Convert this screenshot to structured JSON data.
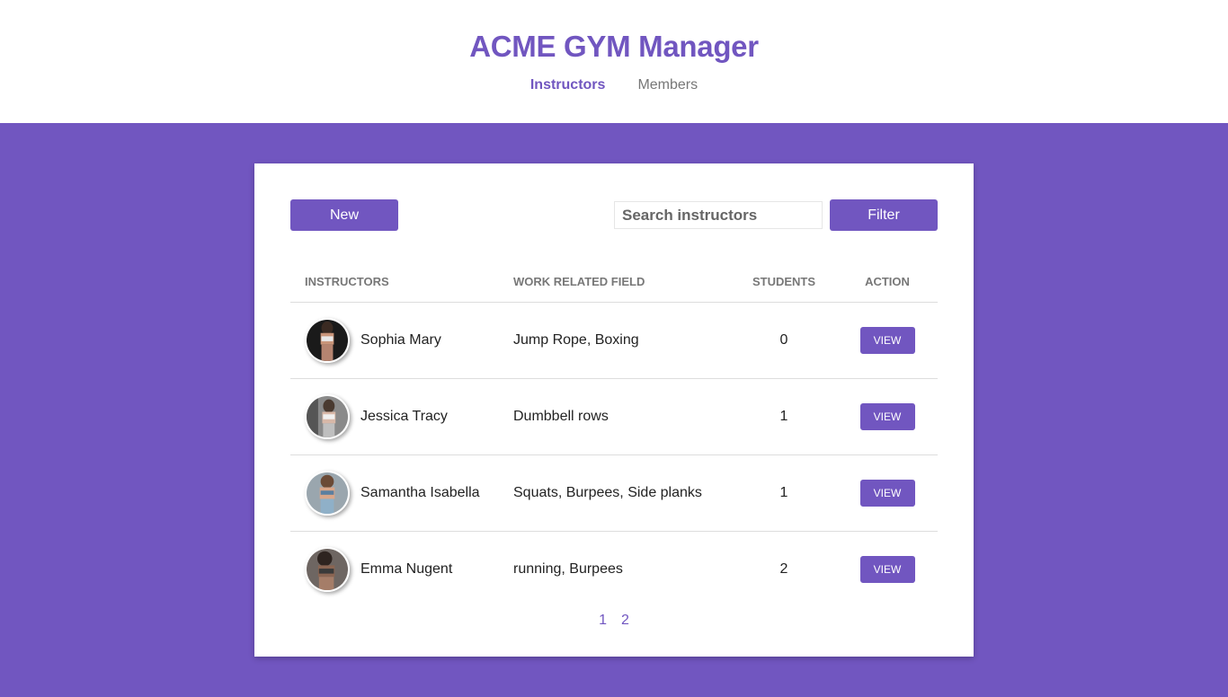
{
  "app": {
    "title": "ACME GYM Manager"
  },
  "nav": {
    "items": [
      {
        "label": "Instructors",
        "active": true
      },
      {
        "label": "Members",
        "active": false
      }
    ]
  },
  "toolbar": {
    "new_label": "New",
    "search_placeholder": "Search instructors",
    "search_value": "",
    "filter_label": "Filter"
  },
  "table": {
    "headers": {
      "instructors": "INSTRUCTORS",
      "field": "WORK RELATED FIELD",
      "students": "STUDENTS",
      "action": "ACTION"
    },
    "rows": [
      {
        "name": "Sophia Mary",
        "field": "Jump Rope, Boxing",
        "students": "0",
        "action": "VIEW"
      },
      {
        "name": "Jessica Tracy",
        "field": "Dumbbell rows",
        "students": "1",
        "action": "VIEW"
      },
      {
        "name": "Samantha Isabella",
        "field": "Squats, Burpees, Side planks",
        "students": "1",
        "action": "VIEW"
      },
      {
        "name": "Emma Nugent",
        "field": "running, Burpees",
        "students": "2",
        "action": "VIEW"
      }
    ]
  },
  "pagination": {
    "pages": [
      "1",
      "2"
    ]
  },
  "colors": {
    "accent": "#7156c0",
    "background": "#7156c0",
    "card": "#ffffff",
    "muted_text": "#777777"
  }
}
